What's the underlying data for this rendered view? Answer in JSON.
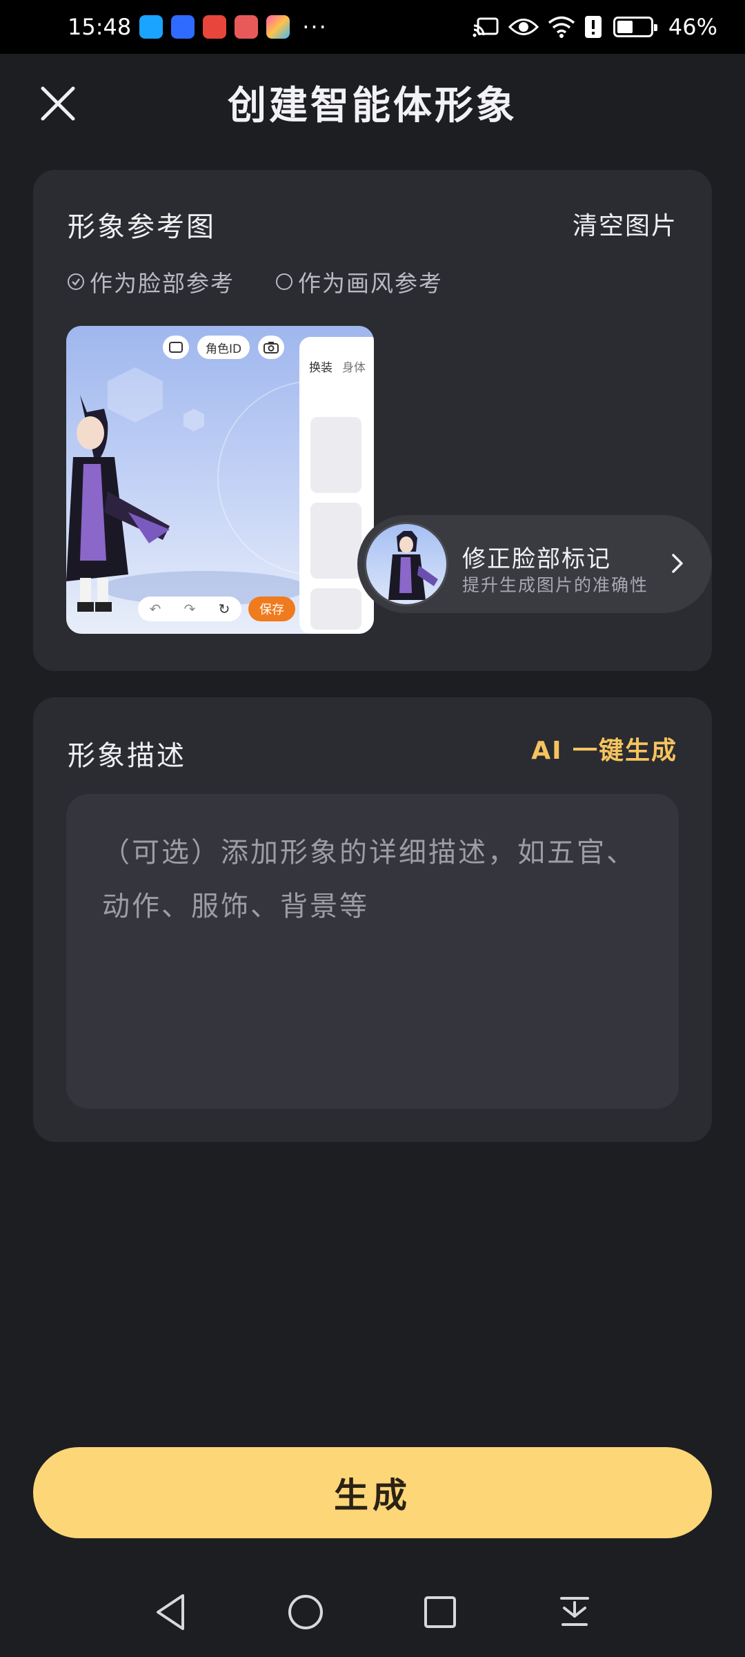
{
  "status_bar": {
    "time": "15:48",
    "more": "···",
    "battery": "46%"
  },
  "header": {
    "title": "创建智能体形象"
  },
  "reference": {
    "title": "形象参考图",
    "clear_label": "清空图片",
    "options": [
      {
        "label": "作为脸部参考",
        "selected": true
      },
      {
        "label": "作为画风参考",
        "selected": false
      }
    ],
    "image": {
      "role_id_label": "角色ID",
      "tab_outfit": "换装",
      "tab_body": "身体",
      "save_label": "保存"
    },
    "fix_face": {
      "title": "修正脸部标记",
      "subtitle": "提升生成图片的准确性"
    }
  },
  "description": {
    "title": "形象描述",
    "ai_label": "AI 一键生成",
    "placeholder": "（可选）添加形象的详细描述，如五官、动作、服饰、背景等",
    "value": ""
  },
  "generate": {
    "label": "生成"
  },
  "colors": {
    "accent": "#fdd678",
    "ai_text": "#f6c45e",
    "background": "#1d1e22",
    "card": "#2b2c31"
  }
}
